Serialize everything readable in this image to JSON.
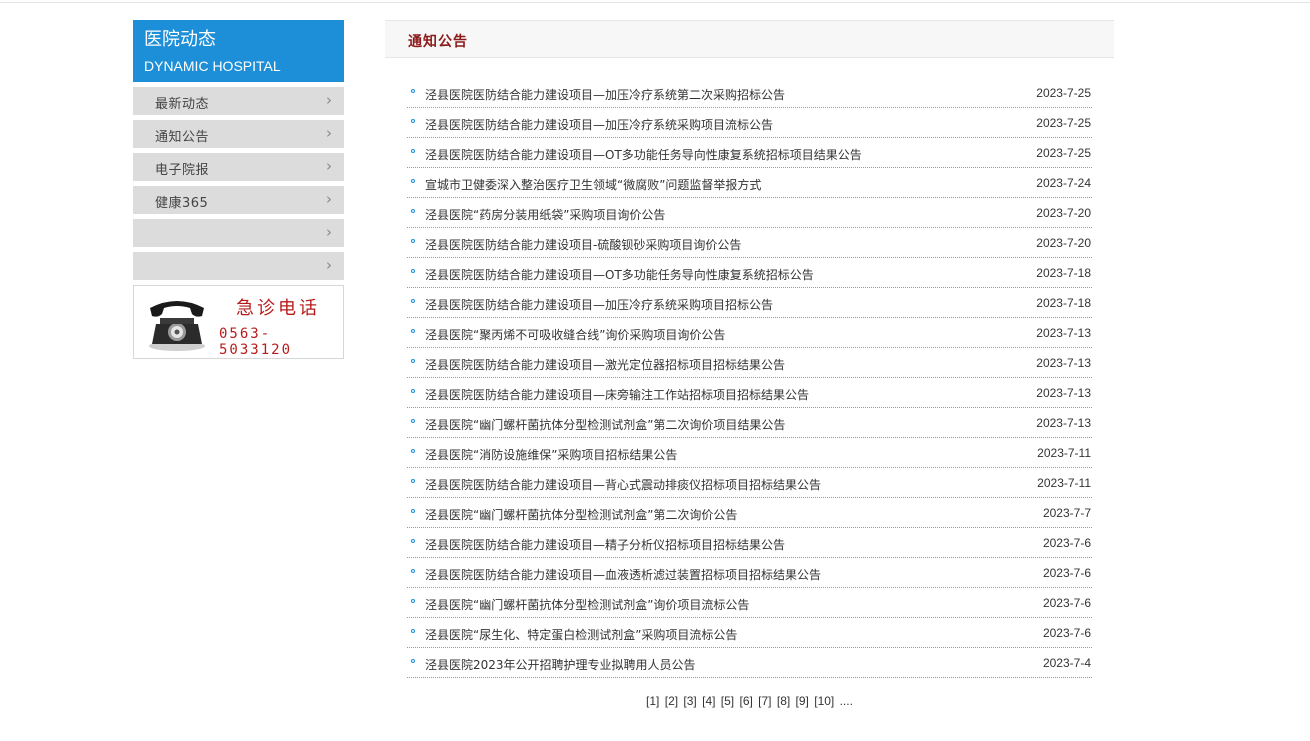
{
  "sidebar": {
    "title_cn": "医院动态",
    "title_en": "DYNAMIC HOSPITAL",
    "items": [
      {
        "label": "最新动态"
      },
      {
        "label": "通知公告"
      },
      {
        "label": "电子院报"
      },
      {
        "label": "健康365"
      },
      {
        "label": ""
      },
      {
        "label": ""
      }
    ],
    "chevron": "›",
    "phone": {
      "icon": "telephone-icon",
      "title": "急诊电话",
      "number": "0563-5033120"
    }
  },
  "main": {
    "title": "通知公告",
    "items": [
      {
        "title": "泾县医院医防结合能力建设项目—加压冷疗系统第二次采购招标公告",
        "date": "2023-7-25"
      },
      {
        "title": "泾县医院医防结合能力建设项目—加压冷疗系统采购项目流标公告",
        "date": "2023-7-25"
      },
      {
        "title": "泾县医院医防结合能力建设项目—OT多功能任务导向性康复系统招标项目结果公告",
        "date": "2023-7-25"
      },
      {
        "title": "宣城市卫健委深入整治医疗卫生领域“微腐败”问题监督举报方式",
        "date": "2023-7-24"
      },
      {
        "title": "泾县医院“药房分装用纸袋”采购项目询价公告",
        "date": "2023-7-20"
      },
      {
        "title": "泾县医院医防结合能力建设项目-硫酸钡砂采购项目询价公告",
        "date": "2023-7-20"
      },
      {
        "title": "泾县医院医防结合能力建设项目—OT多功能任务导向性康复系统招标公告",
        "date": "2023-7-18"
      },
      {
        "title": "泾县医院医防结合能力建设项目—加压冷疗系统采购项目招标公告",
        "date": "2023-7-18"
      },
      {
        "title": "泾县医院“聚丙烯不可吸收缝合线”询价采购项目询价公告",
        "date": "2023-7-13"
      },
      {
        "title": "泾县医院医防结合能力建设项目—激光定位器招标项目招标结果公告",
        "date": "2023-7-13"
      },
      {
        "title": "泾县医院医防结合能力建设项目—床旁输注工作站招标项目招标结果公告",
        "date": "2023-7-13"
      },
      {
        "title": "泾县医院“幽门螺杆菌抗体分型检测试剂盒”第二次询价项目结果公告",
        "date": "2023-7-13"
      },
      {
        "title": "泾县医院“消防设施维保”采购项目招标结果公告",
        "date": "2023-7-11"
      },
      {
        "title": "泾县医院医防结合能力建设项目—背心式震动排痰仪招标项目招标结果公告",
        "date": "2023-7-11"
      },
      {
        "title": "泾县医院“幽门螺杆菌抗体分型检测试剂盒”第二次询价公告",
        "date": "2023-7-7"
      },
      {
        "title": "泾县医院医防结合能力建设项目—精子分析仪招标项目招标结果公告",
        "date": "2023-7-6"
      },
      {
        "title": "泾县医院医防结合能力建设项目—血液透析滤过装置招标项目招标结果公告",
        "date": "2023-7-6"
      },
      {
        "title": "泾县医院“幽门螺杆菌抗体分型检测试剂盒”询价项目流标公告",
        "date": "2023-7-6"
      },
      {
        "title": "泾县医院“尿生化、特定蛋白检测试剂盒”采购项目流标公告",
        "date": "2023-7-6"
      },
      {
        "title": "泾县医院2023年公开招聘护理专业拟聘用人员公告",
        "date": "2023-7-4"
      }
    ]
  },
  "pager": {
    "pages": [
      "[1]",
      "[2]",
      "[3]",
      "[4]",
      "[5]",
      "[6]",
      "[7]",
      "[8]",
      "[9]",
      "[10]"
    ],
    "more": "...."
  },
  "colors": {
    "sidebar_header": "#1d8fd8",
    "menu_bg": "#dcdcdc",
    "title_red": "#8b1a1a",
    "phone_red": "#b71c1c",
    "bullet_blue": "#1d8fd8"
  }
}
